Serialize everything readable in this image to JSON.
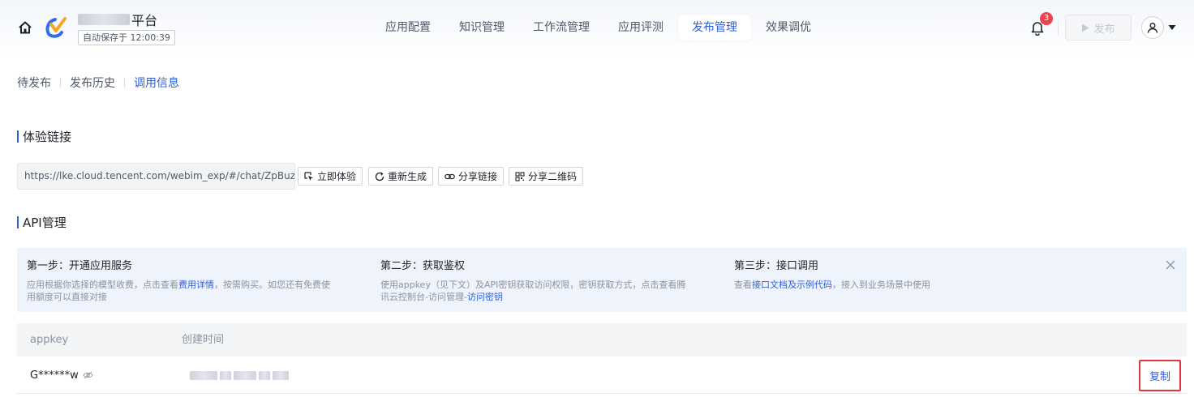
{
  "header": {
    "app_name_suffix": "平台",
    "autosave_text": "自动保存于 12:00:39",
    "tabs": [
      {
        "label": "应用配置"
      },
      {
        "label": "知识管理"
      },
      {
        "label": "工作流管理"
      },
      {
        "label": "应用评测"
      },
      {
        "label": "发布管理",
        "active": true
      },
      {
        "label": "效果调优"
      }
    ],
    "notification_count": "3",
    "publish_label": "发布",
    "accent_color": "#2f5fd6"
  },
  "subtabs": [
    {
      "label": "待发布"
    },
    {
      "label": "发布历史"
    },
    {
      "label": "调用信息",
      "active": true
    }
  ],
  "experience": {
    "title": "体验链接",
    "link": "https://lke.cloud.tencent.com/webim_exp/#/chat/ZpBuzf",
    "buttons": {
      "try_now": "立即体验",
      "regenerate": "重新生成",
      "share_link": "分享链接",
      "share_qr": "分享二维码"
    }
  },
  "api": {
    "title": "API管理",
    "steps": [
      {
        "title": "第一步：开通应用服务",
        "desc_pre": "应用根据你选择的模型收费，点击查看",
        "desc_link": "费用详情",
        "desc_post": "，按需购买。如您还有免费使",
        "desc_line2": "用额度可以直接对接"
      },
      {
        "title": "第二步：获取鉴权",
        "desc_line1": "使用appkey（见下文）及API密钥获取访问权限，密钥获取方式，点击查看腾",
        "desc_pre2": "讯云控制台-访问管理-",
        "desc_link": "访问密钥"
      },
      {
        "title": "第三步：接口调用",
        "desc_pre": "查看",
        "desc_link": "接口文档及示例代码",
        "desc_post": "，接入到业务场景中使用"
      }
    ],
    "table": {
      "columns": [
        "appkey",
        "创建时间"
      ],
      "rows": [
        {
          "appkey": "G******w",
          "action": "复制"
        }
      ]
    }
  }
}
